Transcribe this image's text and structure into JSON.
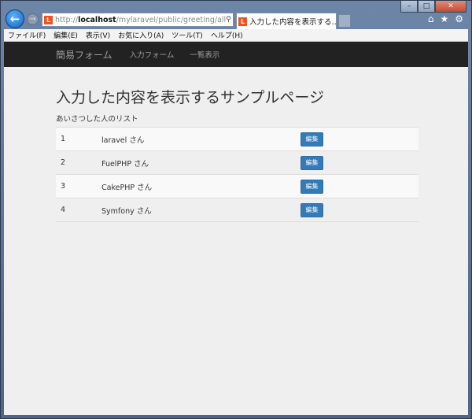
{
  "browser": {
    "address": {
      "prefix": "http://",
      "host": "localhost",
      "path": "/mylaravel/public/greeting/all",
      "favicon_icon": "laravel-logo-icon"
    },
    "tab": {
      "title": "入力した内容を表示する…",
      "close": "×"
    },
    "menu": [
      "ファイル(F)",
      "編集(E)",
      "表示(V)",
      "お気に入り(A)",
      "ツール(T)",
      "ヘルプ(H)"
    ]
  },
  "navbar": {
    "brand": "簡易フォーム",
    "links": [
      "入力フォーム",
      "一覧表示"
    ]
  },
  "main": {
    "title": "入力した内容を表示するサンプルページ",
    "subtitle": "あいさつした人のリスト",
    "rows": [
      {
        "id": "1",
        "name": "laravel さん",
        "action": "編集"
      },
      {
        "id": "2",
        "name": "FuelPHP さん",
        "action": "編集"
      },
      {
        "id": "3",
        "name": "CakePHP さん",
        "action": "編集"
      },
      {
        "id": "4",
        "name": "Symfony さん",
        "action": "編集"
      }
    ]
  },
  "colors": {
    "navbar_bg": "#222222",
    "button_primary": "#337ab7",
    "page_bg": "#efefef"
  }
}
